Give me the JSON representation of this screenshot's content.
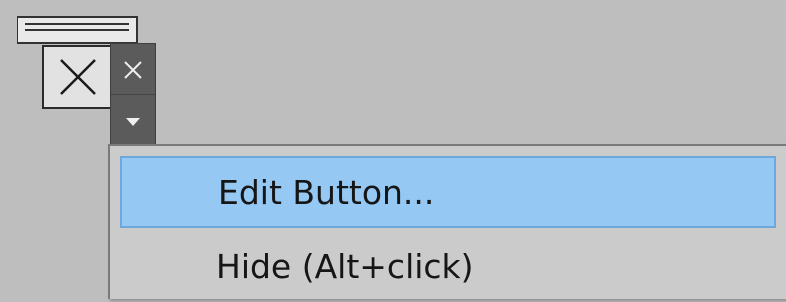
{
  "quick_access_button": {
    "icon": "close-window-icon",
    "hover_close_icon": "close-icon",
    "hover_dropdown_icon": "dropdown-arrow-icon"
  },
  "context_menu": {
    "items": [
      {
        "label": "Edit Button...",
        "state": "highlighted"
      },
      {
        "label": "Hide (Alt+click)",
        "state": "normal"
      }
    ]
  },
  "colors": {
    "background": "#bebebe",
    "highlight": "#95c8f3",
    "highlight_border": "#6fa8da",
    "strip": "#5b5b5b",
    "menu": "#cbcbcb"
  }
}
